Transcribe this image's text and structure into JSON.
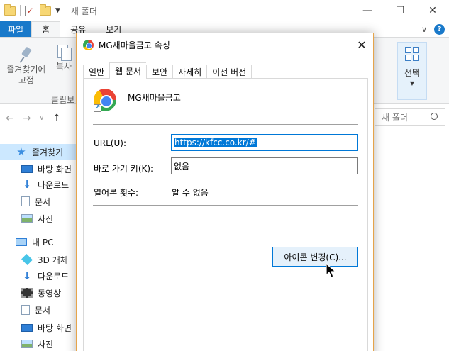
{
  "explorer": {
    "title": "새 폴더",
    "ribbon_tabs": [
      "파일",
      "홈",
      "공유",
      "보기"
    ],
    "ribbon": {
      "pin_label": "즐겨찾기에\n고정",
      "copy_label": "복사",
      "group_clipboard": "클립보",
      "select_label": "선택"
    },
    "search_placeholder": "새 폴더",
    "nav": {
      "quick_access": "즐겨찾기",
      "qa_items": [
        "바탕 화면",
        "다운로드",
        "문서",
        "사진"
      ],
      "this_pc": "내 PC",
      "pc_items": [
        "3D 개체",
        "다운로드",
        "동영상",
        "문서",
        "바탕 화면",
        "사진"
      ]
    }
  },
  "dialog": {
    "title": "MG새마을금고 속성",
    "tabs": [
      "일반",
      "웹 문서",
      "보안",
      "자세히",
      "이전 버전"
    ],
    "active_tab": "웹 문서",
    "name": "MG새마을금고",
    "url_label": "URL(U):",
    "url_value": "https://kfcc.co.kr/#",
    "hotkey_label": "바로 가기 키(K):",
    "hotkey_value": "없음",
    "visits_label": "열어본 횟수:",
    "visits_value": "알 수 없음",
    "change_icon_button": "아이콘 변경(C)..."
  },
  "colors": {
    "accent": "#0078d7",
    "file_tab": "#1979ca",
    "dialog_border": "#e6a44a"
  }
}
